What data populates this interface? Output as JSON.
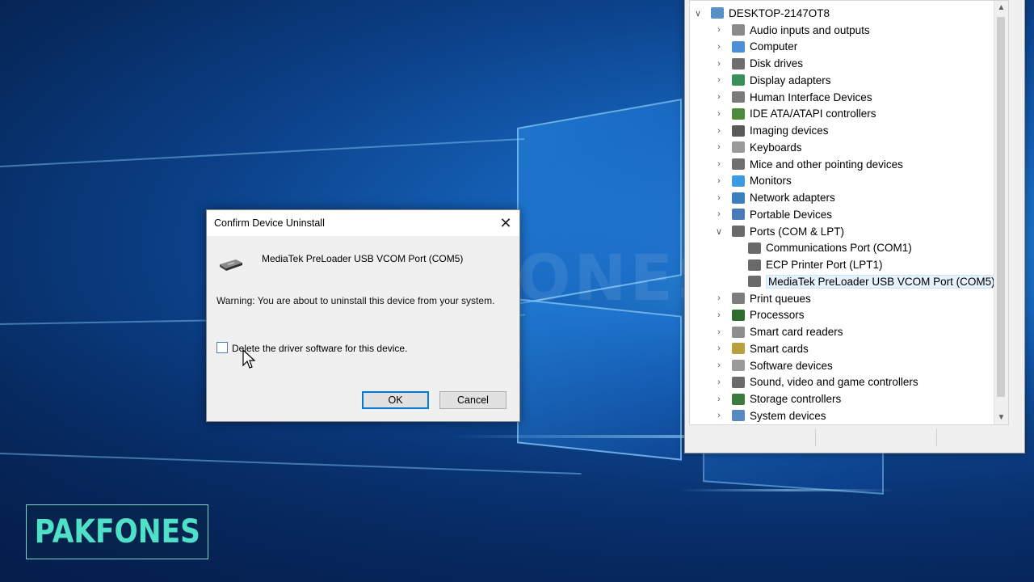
{
  "dialog": {
    "title": "Confirm Device Uninstall",
    "close_glyph": "✕",
    "device_name": "MediaTek PreLoader USB VCOM Port (COM5)",
    "warning": "Warning: You are about to uninstall this device from your system.",
    "checkbox_label": "Delete the driver software for this device.",
    "checkbox_checked": false,
    "ok_label": "OK",
    "cancel_label": "Cancel"
  },
  "device_manager": {
    "root": "DESKTOP-2147OT8",
    "items": [
      {
        "label": "Audio inputs and outputs",
        "icon": "speaker-icon",
        "expanded": false
      },
      {
        "label": "Computer",
        "icon": "computer-icon",
        "expanded": false
      },
      {
        "label": "Disk drives",
        "icon": "disk-drive-icon",
        "expanded": false
      },
      {
        "label": "Display adapters",
        "icon": "display-adapter-icon",
        "expanded": false
      },
      {
        "label": "Human Interface Devices",
        "icon": "hid-icon",
        "expanded": false
      },
      {
        "label": "IDE ATA/ATAPI controllers",
        "icon": "ide-controller-icon",
        "expanded": false
      },
      {
        "label": "Imaging devices",
        "icon": "camera-icon",
        "expanded": false
      },
      {
        "label": "Keyboards",
        "icon": "keyboard-icon",
        "expanded": false
      },
      {
        "label": "Mice and other pointing devices",
        "icon": "mouse-icon",
        "expanded": false
      },
      {
        "label": "Monitors",
        "icon": "monitor-icon",
        "expanded": false
      },
      {
        "label": "Network adapters",
        "icon": "network-adapter-icon",
        "expanded": false
      },
      {
        "label": "Portable Devices",
        "icon": "portable-device-icon",
        "expanded": false
      },
      {
        "label": "Ports (COM & LPT)",
        "icon": "port-icon",
        "expanded": true
      },
      {
        "label": "Communications Port (COM1)",
        "icon": "port-icon",
        "child": true
      },
      {
        "label": "ECP Printer Port (LPT1)",
        "icon": "port-icon",
        "child": true
      },
      {
        "label": "MediaTek PreLoader USB VCOM Port (COM5)",
        "icon": "port-icon",
        "child": true,
        "selected": true
      },
      {
        "label": "Print queues",
        "icon": "printer-icon",
        "expanded": false
      },
      {
        "label": "Processors",
        "icon": "processor-icon",
        "expanded": false
      },
      {
        "label": "Smart card readers",
        "icon": "smart-card-reader-icon",
        "expanded": false
      },
      {
        "label": "Smart cards",
        "icon": "smart-card-icon",
        "expanded": false
      },
      {
        "label": "Software devices",
        "icon": "software-device-icon",
        "expanded": false
      },
      {
        "label": "Sound, video and game controllers",
        "icon": "sound-icon",
        "expanded": false
      },
      {
        "label": "Storage controllers",
        "icon": "storage-controller-icon",
        "expanded": false
      },
      {
        "label": "System devices",
        "icon": "system-device-icon",
        "expanded": false
      }
    ]
  },
  "watermark": {
    "badge": "PAKFONES",
    "overlay": "PAKFONES"
  },
  "colors": {
    "accent": "#0078d7",
    "badge_text": "#4fe0c8",
    "selection": "#e5f1fb"
  }
}
